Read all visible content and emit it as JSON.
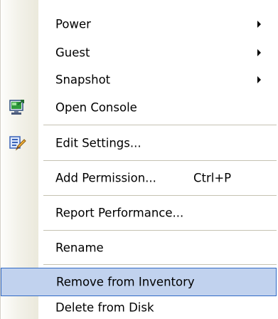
{
  "menu": {
    "items": {
      "power": {
        "label": "Power",
        "submenu": true
      },
      "guest": {
        "label": "Guest",
        "submenu": true
      },
      "snapshot": {
        "label": "Snapshot",
        "submenu": true
      },
      "open_console": {
        "label": "Open Console",
        "icon": "console-icon"
      },
      "edit_settings": {
        "label": "Edit Settings...",
        "icon": "edit-settings-icon"
      },
      "add_permission": {
        "label": "Add Permission...",
        "shortcut": "Ctrl+P"
      },
      "report_performance": {
        "label": "Report Performance..."
      },
      "rename": {
        "label": "Rename"
      },
      "remove_from_inventory": {
        "label": "Remove from Inventory",
        "highlighted": true
      },
      "delete_from_disk": {
        "label": "Delete from Disk"
      }
    },
    "colors": {
      "highlight_fill": "#c1d2ee",
      "highlight_border": "#316ac5",
      "separator": "#c5c2b2",
      "gutter": "#ebe9dc"
    }
  }
}
